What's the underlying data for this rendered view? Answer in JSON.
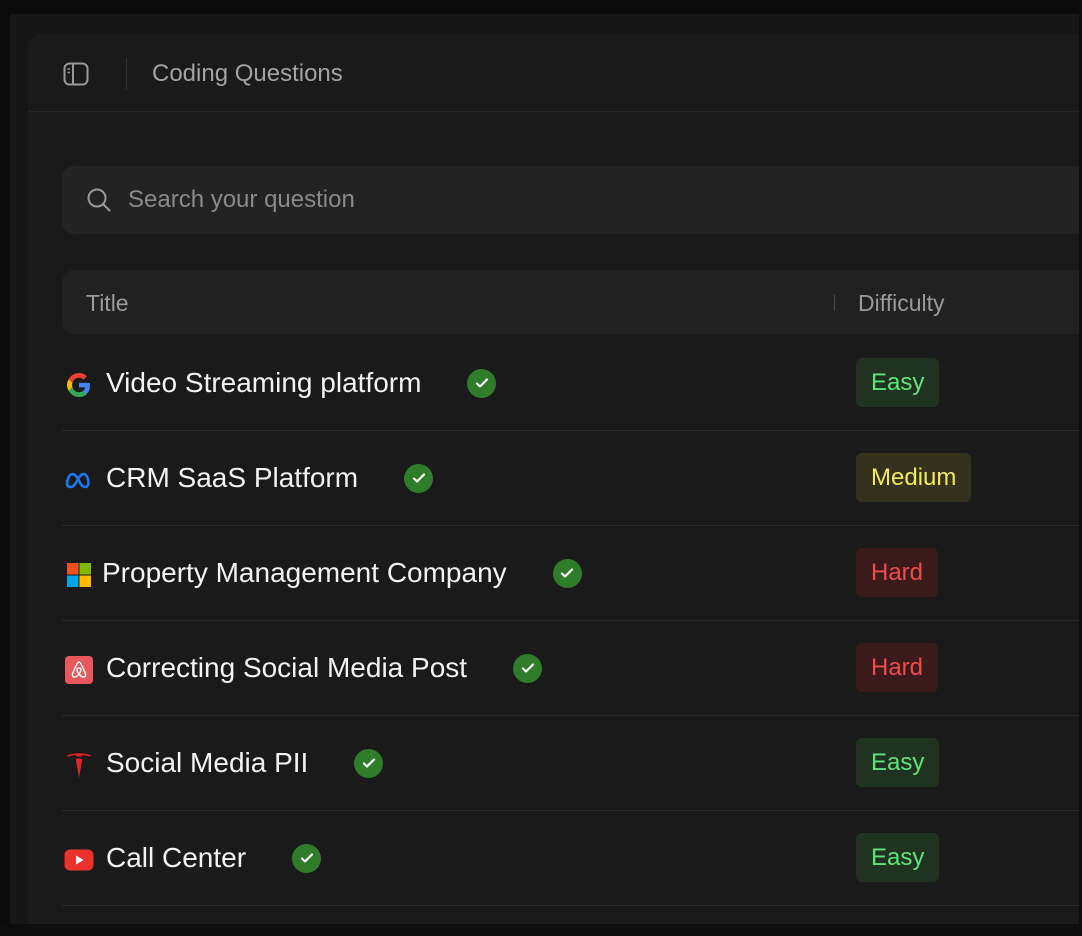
{
  "header": {
    "title": "Coding Questions"
  },
  "search": {
    "placeholder": "Search your question"
  },
  "table": {
    "columns": [
      "Title",
      "Difficulty"
    ],
    "rows": [
      {
        "company_icon": "google-icon",
        "title": "Video Streaming platform",
        "solved": true,
        "difficulty": "Easy"
      },
      {
        "company_icon": "meta-icon",
        "title": "CRM SaaS Platform",
        "solved": true,
        "difficulty": "Medium"
      },
      {
        "company_icon": "microsoft-icon",
        "title": "Property Management Company",
        "solved": true,
        "difficulty": "Hard"
      },
      {
        "company_icon": "airbnb-icon",
        "title": "Correcting Social Media Post",
        "solved": true,
        "difficulty": "Hard"
      },
      {
        "company_icon": "tesla-icon",
        "title": "Social Media PII",
        "solved": true,
        "difficulty": "Easy"
      },
      {
        "company_icon": "youtube-icon",
        "title": "Call Center",
        "solved": true,
        "difficulty": "Easy"
      }
    ]
  },
  "colors": {
    "easy_text": "#5fe37a",
    "medium_text": "#f3e95a",
    "hard_text": "#f04b4b",
    "check_green": "#2f7d2a"
  }
}
